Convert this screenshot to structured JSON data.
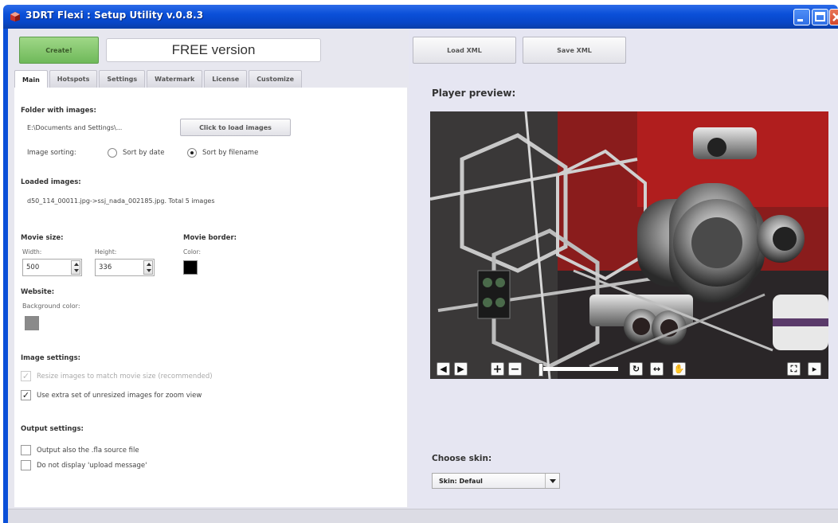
{
  "window": {
    "title": "3DRT Flexi : Setup Utility v.0.8.3"
  },
  "toolbar": {
    "create_label": "Create!",
    "version_label": "FREE version",
    "load_xml_label": "Load XML",
    "save_xml_label": "Save XML"
  },
  "tabs": [
    {
      "label": "Main",
      "active": true
    },
    {
      "label": "Hotspots"
    },
    {
      "label": "Settings"
    },
    {
      "label": "Watermark"
    },
    {
      "label": "License"
    },
    {
      "label": "Customize"
    }
  ],
  "main": {
    "folder_heading": "Folder with images:",
    "folder_path": "E:\\Documents and Settings\\...",
    "load_images_label": "Click to load images",
    "sorting_label": "Image sorting:",
    "sort_by_date": "Sort by date",
    "sort_by_filename": "Sort by filename",
    "sort_selected": "filename",
    "loaded_heading": "Loaded images:",
    "loaded_text": "d50_114_00011.jpg->ssj_nada_002185.jpg. Total 5 images",
    "movie_size_heading": "Movie size:",
    "width_label": "Width:",
    "width_value": "500",
    "height_label": "Height:",
    "height_value": "336",
    "movie_border_heading": "Movie border:",
    "border_color_label": "Color:",
    "border_color": "#000000",
    "website_heading": "Website:",
    "bg_color_label": "Background color:",
    "bg_color": "#8a8a8a",
    "image_settings_heading": "Image settings:",
    "resize_label": "Resize images to match movie size (recommended)",
    "resize_checked": true,
    "resize_disabled": true,
    "extra_set_label": "Use extra set of unresized images for zoom view",
    "extra_set_checked": true,
    "output_heading": "Output settings:",
    "output_fla_label": "Output also the .fla source file",
    "output_fla_checked": false,
    "no_upload_label": "Do not display 'upload message'",
    "no_upload_checked": false
  },
  "preview": {
    "label": "Player preview:",
    "controls": [
      "arrow-left-icon",
      "arrow-right-icon",
      "zoom-in-icon",
      "zoom-out-icon",
      "zoom-slider",
      "rotate-icon",
      "flip-icon",
      "hand-icon",
      "fullscreen-icon",
      "next-icon"
    ]
  },
  "skin": {
    "label": "Choose skin:",
    "selected": "Skin: Defaul"
  }
}
